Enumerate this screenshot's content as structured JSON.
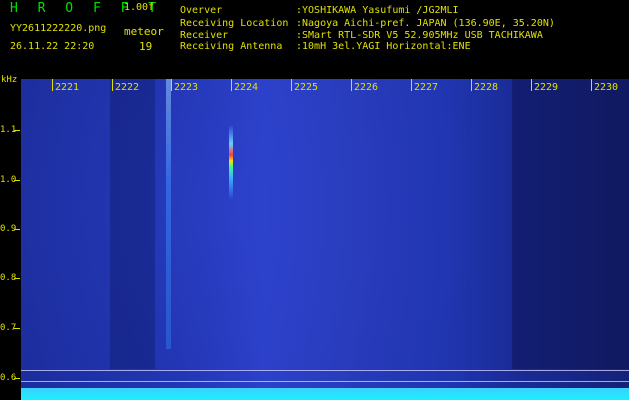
{
  "header": {
    "brand": "H R O F F T",
    "version": "1.00f",
    "filename": "YY2611222220.png",
    "datetime": "26.11.22 22:20",
    "meteor_label": "meteor",
    "meteor_count": "19"
  },
  "info": [
    {
      "label": "Overver",
      "value": ":YOSHIKAWA Yasufumi /JG2MLI"
    },
    {
      "label": "Receiving Location",
      "value": ":Nagoya Aichi-pref. JAPAN (136.90E, 35.20N)"
    },
    {
      "label": "Receiver",
      "value": ":SMart RTL-SDR V5 52.905MHz USB TACHIKAWA"
    },
    {
      "label": "Receiving Antenna",
      "value": ":10mH 3el.YAGI Horizontal:ENE"
    }
  ],
  "axis": {
    "y_unit": "kHz",
    "y_ticks": [
      "1.1",
      "1.0",
      "0.9",
      "0.8",
      "0.7",
      "0.6"
    ],
    "x_ticks": [
      "2221",
      "2222",
      "2223",
      "2224",
      "2225",
      "2226",
      "2227",
      "2228",
      "2229",
      "2230"
    ]
  },
  "colors": {
    "text_yellow": "#e0e000",
    "brand_green": "#00e000",
    "background_blue": "#2236b5"
  }
}
